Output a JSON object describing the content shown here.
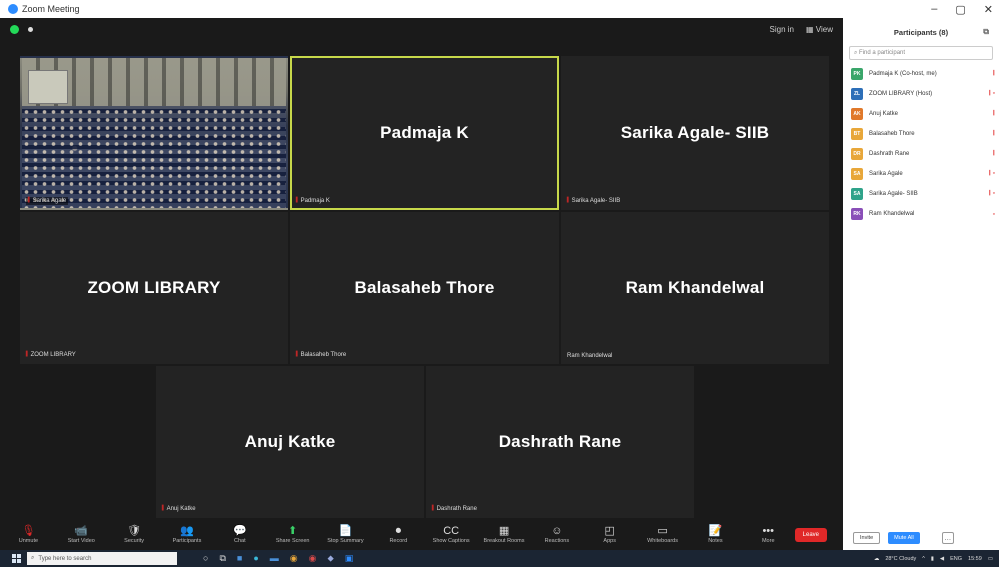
{
  "window": {
    "title": "Zoom Meeting",
    "controls": [
      "–",
      "▢",
      "✕"
    ]
  },
  "topbar": {
    "items": [
      "Sign in",
      "▦ View"
    ]
  },
  "tiles": [
    {
      "id": "audience",
      "name": "",
      "label": "Sarika Agale",
      "type": "video"
    },
    {
      "id": "padmaja",
      "name": "Padmaja K",
      "label": "Padmaja K",
      "active": true
    },
    {
      "id": "sarika-siib",
      "name": "Sarika Agale- SIIB",
      "label": "Sarika Agale- SIIB"
    },
    {
      "id": "zoom-library",
      "name": "ZOOM LIBRARY",
      "label": "ZOOM LIBRARY"
    },
    {
      "id": "balasaheb",
      "name": "Balasaheb Thore",
      "label": "Balasaheb Thore"
    },
    {
      "id": "ram",
      "name": "Ram Khandelwal",
      "label": "Ram Khandelwal"
    },
    {
      "id": "anuj",
      "name": "Anuj Katke",
      "label": "Anuj Katke"
    },
    {
      "id": "dashrath",
      "name": "Dashrath Rane",
      "label": "Dashrath Rane"
    }
  ],
  "toolbar": {
    "buttons": [
      {
        "label": "Unmute",
        "icon": "🎙"
      },
      {
        "label": "Start Video",
        "icon": "📹"
      },
      {
        "label": "Security",
        "icon": "🛡"
      },
      {
        "label": "Participants",
        "icon": "👥"
      },
      {
        "label": "Chat",
        "icon": "💬"
      },
      {
        "label": "Share Screen",
        "icon": "⬆"
      },
      {
        "label": "Stop Summary",
        "icon": "📄"
      },
      {
        "label": "Record",
        "icon": "⏺"
      },
      {
        "label": "Show Captions",
        "icon": "CC"
      },
      {
        "label": "Breakout Rooms",
        "icon": "▦"
      },
      {
        "label": "Reactions",
        "icon": "☺"
      },
      {
        "label": "Apps",
        "icon": "◰"
      },
      {
        "label": "Whiteboards",
        "icon": "▭"
      },
      {
        "label": "Notes",
        "icon": "📝"
      },
      {
        "label": "More",
        "icon": "•••"
      }
    ],
    "leave_label": "Leave"
  },
  "panel": {
    "title": "Participants (8)",
    "search_placeholder": "Find a participant",
    "participants": [
      {
        "initials": "PK",
        "name": "Padmaja K (Co-host, me)",
        "color": "#3aa66a"
      },
      {
        "initials": "ZL",
        "name": "ZOOM LIBRARY (Host)",
        "color": "#2d6fb8"
      },
      {
        "initials": "AK",
        "name": "Anuj Katke",
        "color": "#e0792a"
      },
      {
        "initials": "BT",
        "name": "Balasaheb Thore",
        "color": "#e8a73a"
      },
      {
        "initials": "DR",
        "name": "Dashrath Rane",
        "color": "#e8a73a"
      },
      {
        "initials": "SA",
        "name": "Sarika Agale",
        "color": "#e8a73a"
      },
      {
        "initials": "SA",
        "name": "Sarika Agale- SIIB",
        "color": "#2fa38a"
      },
      {
        "initials": "RK",
        "name": "Ram Khandelwal",
        "color": "#8a4fb8"
      }
    ],
    "invite_label": "Invite",
    "mute_all_label": "Mute All",
    "more_label": "…"
  },
  "taskbar": {
    "search_placeholder": "Type here to search",
    "weather": "28°C Cloudy",
    "language": "ENG",
    "time": "15:59"
  }
}
